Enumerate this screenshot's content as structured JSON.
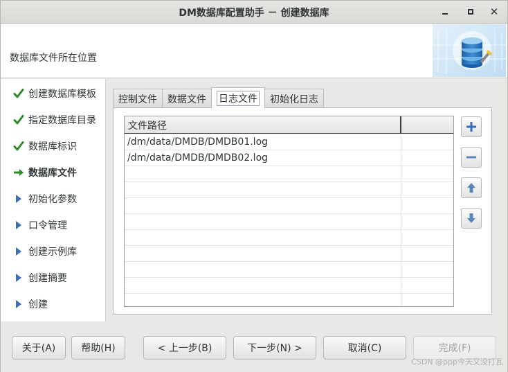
{
  "window": {
    "title": "DM数据库配置助手 － 创建数据库"
  },
  "header": {
    "location_label": "数据库文件所在位置"
  },
  "steps": [
    {
      "label": "创建数据库模板",
      "state": "done"
    },
    {
      "label": "指定数据库目录",
      "state": "done"
    },
    {
      "label": "数据库标识",
      "state": "done"
    },
    {
      "label": "数据库文件",
      "state": "current"
    },
    {
      "label": "初始化参数",
      "state": "pending"
    },
    {
      "label": "口令管理",
      "state": "pending"
    },
    {
      "label": "创建示例库",
      "state": "pending"
    },
    {
      "label": "创建摘要",
      "state": "pending"
    },
    {
      "label": "创建",
      "state": "pending"
    }
  ],
  "tabs": [
    {
      "label": "控制文件"
    },
    {
      "label": "数据文件"
    },
    {
      "label": "日志文件"
    },
    {
      "label": "初始化日志"
    }
  ],
  "active_tab": "日志文件",
  "table": {
    "headers": [
      "文件路径",
      ""
    ],
    "rows": [
      [
        "/dm/data/DMDB/DMDB01.log",
        ""
      ],
      [
        "/dm/data/DMDB/DMDB02.log",
        ""
      ]
    ]
  },
  "side_buttons": [
    {
      "icon": "plus-icon"
    },
    {
      "icon": "minus-icon"
    },
    {
      "icon": "arrow-up-icon"
    },
    {
      "icon": "arrow-down-icon"
    }
  ],
  "footer": {
    "about": "关于(A)",
    "help": "帮助(H)",
    "prev": "< 上一步(B)",
    "next": "下一步(N) >",
    "cancel": "取消(C)",
    "finish": "完成(F)"
  },
  "watermark": "CSDN @ppp今天又没打瓦",
  "colors": {
    "accent": "#3d6fb8",
    "check": "#2e8b2e",
    "current_arrow": "#2e8b2e"
  }
}
